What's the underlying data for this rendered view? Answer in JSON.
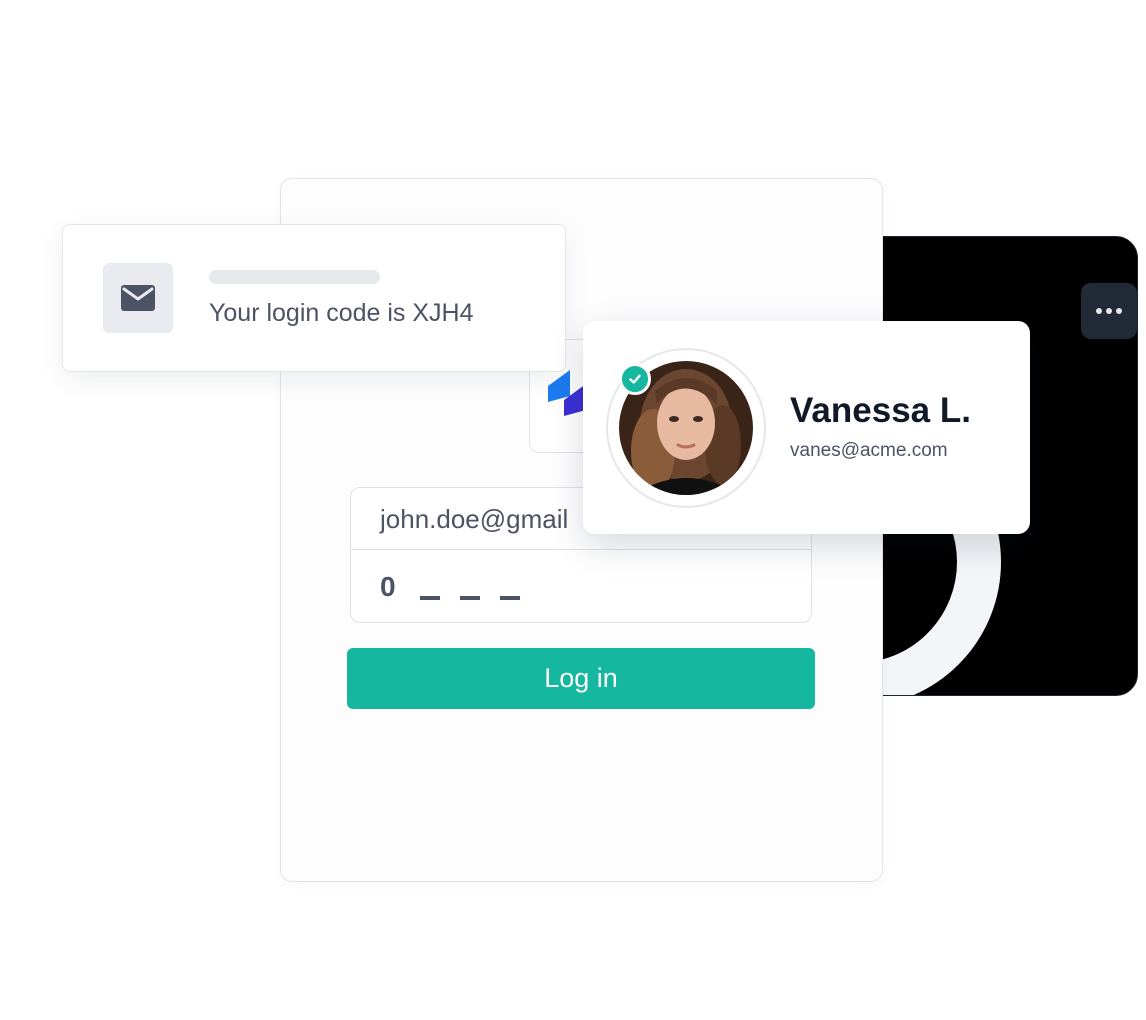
{
  "colors": {
    "accent": "#15b79e",
    "text_muted": "#4b5365",
    "text_dark": "#111827",
    "dark_card": "#000000",
    "more_button": "#222a38"
  },
  "dark_card": {
    "more_icon": "ellipsis-icon"
  },
  "login_form": {
    "email_value": "john.doe@gmail",
    "code_digits": [
      "0",
      "",
      "",
      ""
    ],
    "login_label": "Log in"
  },
  "notification": {
    "icon": "envelope-icon",
    "message": "Your login code is XJH4"
  },
  "profile": {
    "name": "Vanessa L.",
    "email": "vanes@acme.com",
    "verified_icon": "check-icon"
  }
}
